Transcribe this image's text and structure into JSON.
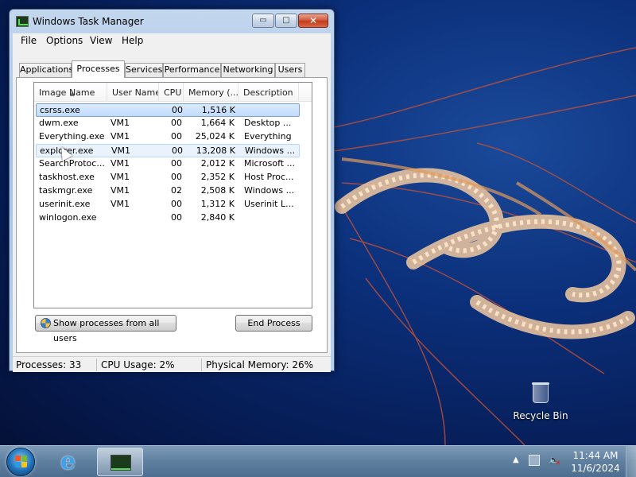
{
  "window": {
    "title": "Windows Task Manager",
    "controls": {
      "minimize": "▭",
      "maximize": "□",
      "close": "✕"
    }
  },
  "menu": [
    "File",
    "Options",
    "View",
    "Help"
  ],
  "tabs": [
    "Applications",
    "Processes",
    "Services",
    "Performance",
    "Networking",
    "Users"
  ],
  "active_tab": "Processes",
  "columns": [
    "Image Name",
    "User Name",
    "CPU",
    "Memory (...",
    "Description"
  ],
  "processes": [
    {
      "name": "csrss.exe",
      "user": "",
      "cpu": "00",
      "memory": "1,516 K",
      "description": ""
    },
    {
      "name": "dwm.exe",
      "user": "VM1",
      "cpu": "00",
      "memory": "1,664 K",
      "description": "Desktop ..."
    },
    {
      "name": "Everything.exe",
      "user": "VM1",
      "cpu": "00",
      "memory": "25,024 K",
      "description": "Everything"
    },
    {
      "name": "explorer.exe",
      "user": "VM1",
      "cpu": "00",
      "memory": "13,208 K",
      "description": "Windows ..."
    },
    {
      "name": "SearchProtoc...",
      "user": "VM1",
      "cpu": "00",
      "memory": "2,012 K",
      "description": "Microsoft ..."
    },
    {
      "name": "taskhost.exe",
      "user": "VM1",
      "cpu": "00",
      "memory": "2,352 K",
      "description": "Host Proc..."
    },
    {
      "name": "taskmgr.exe",
      "user": "VM1",
      "cpu": "02",
      "memory": "2,508 K",
      "description": "Windows ..."
    },
    {
      "name": "userinit.exe",
      "user": "VM1",
      "cpu": "00",
      "memory": "1,312 K",
      "description": "Userinit L..."
    },
    {
      "name": "winlogon.exe",
      "user": "",
      "cpu": "00",
      "memory": "2,840 K",
      "description": ""
    }
  ],
  "buttons": {
    "show_all": "Show processes from all users",
    "end_process": "End Process"
  },
  "status": {
    "processes": "Processes: 33",
    "cpu": "CPU Usage: 2%",
    "memory": "Physical Memory: 26%"
  },
  "desktop": {
    "recycle_bin": "Recycle Bin"
  },
  "taskbar": {
    "time": "11:44 AM",
    "date": "11/6/2024",
    "tray_arrow": "▲"
  },
  "colors": {
    "desktop_bg": "#0b2f7a",
    "selection": "#c1dbfc",
    "taskbar": "#5f7f9f"
  }
}
